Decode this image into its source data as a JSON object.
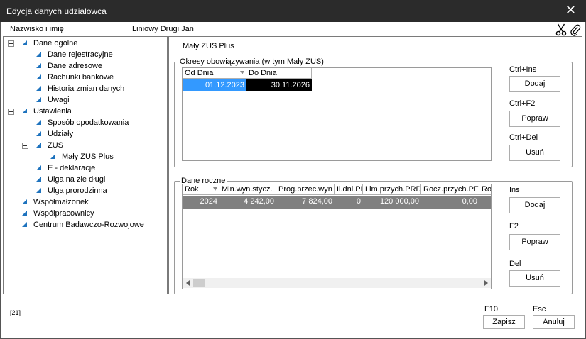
{
  "window": {
    "title": "Edycja danych udziałowca",
    "close_glyph": "✕"
  },
  "header": {
    "name_label": "Nazwisko i imię",
    "name_value": "Liniowy Drugi Jan",
    "icons": [
      "scissors-icon",
      "paperclip-icon"
    ]
  },
  "tree": {
    "items": [
      {
        "label": "Dane ogólne",
        "level": 0,
        "expanded": true
      },
      {
        "label": "Dane rejestracyjne",
        "level": 1
      },
      {
        "label": "Dane adresowe",
        "level": 1
      },
      {
        "label": "Rachunki bankowe",
        "level": 1
      },
      {
        "label": "Historia zmian danych",
        "level": 1
      },
      {
        "label": "Uwagi",
        "level": 1
      },
      {
        "label": "Ustawienia",
        "level": 0,
        "expanded": true
      },
      {
        "label": "Sposób opodatkowania",
        "level": 1
      },
      {
        "label": "Udziały",
        "level": 1
      },
      {
        "label": "ZUS",
        "level": 1,
        "expanded": true
      },
      {
        "label": "Mały ZUS Plus",
        "level": 2
      },
      {
        "label": "E - deklaracje",
        "level": 1
      },
      {
        "label": "Ulga na złe długi",
        "level": 1
      },
      {
        "label": "Ulga prorodzinna",
        "level": 1
      },
      {
        "label": "Współmałżonek",
        "level": 0
      },
      {
        "label": "Współpracownicy",
        "level": 0
      },
      {
        "label": "Centrum Badawczo-Rozwojowe",
        "level": 0
      }
    ]
  },
  "section_title": "Mały ZUS Plus",
  "periods": {
    "legend": "Okresy obowiązywania (w tym Mały ZUS)",
    "columns": [
      "Od Dnia",
      "Do Dnia"
    ],
    "rows": [
      [
        "01.12.2023",
        "30.11.2026"
      ]
    ],
    "add": {
      "shortcut": "Ctrl+Ins",
      "label": "Dodaj"
    },
    "edit": {
      "shortcut": "Ctrl+F2",
      "label": "Popraw"
    },
    "remove": {
      "shortcut": "Ctrl+Del",
      "label": "Usuń"
    }
  },
  "annual": {
    "legend": "Dane roczne",
    "columns": [
      "Rok",
      "Min.wyn.stycz.",
      "Prog.przec.wyn",
      "Il.dni.PF",
      "Lim.przych.PRD",
      "Rocz.przych.PF",
      "Roc"
    ],
    "rows": [
      [
        "2024",
        "4 242,00",
        "7 824,00",
        "0",
        "120 000,00",
        "0,00",
        ""
      ]
    ],
    "add": {
      "shortcut": "Ins",
      "label": "Dodaj"
    },
    "edit": {
      "shortcut": "F2",
      "label": "Popraw"
    },
    "remove": {
      "shortcut": "Del",
      "label": "Usuń"
    }
  },
  "footer": {
    "code": "[21]",
    "save": {
      "shortcut": "F10",
      "label": "Zapisz"
    },
    "cancel": {
      "shortcut": "Esc",
      "label": "Anuluj"
    }
  },
  "colors": {
    "titlebar": "#2b2b2b",
    "selection_blue": "#3399ff",
    "selection_black": "#000000",
    "row_gray": "#808080",
    "tree_triangle": "#1e73be"
  }
}
